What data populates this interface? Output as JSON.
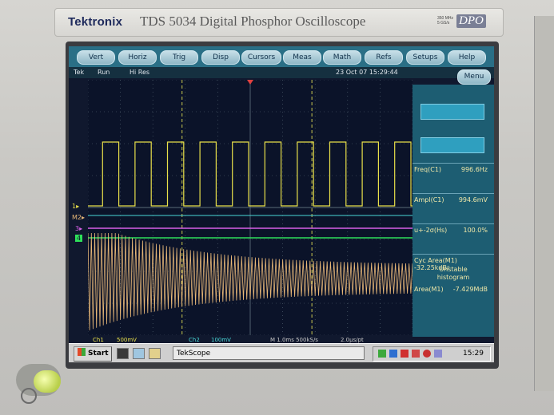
{
  "brand": {
    "logo": "Tektronix",
    "model": "TDS 5034 Digital Phosphor Oscilloscope",
    "spec_line1": "350 MHz",
    "spec_line2": "5 GS/s",
    "badge": "DPO"
  },
  "menu": [
    {
      "label": "Vert"
    },
    {
      "label": "Horiz"
    },
    {
      "label": "Trig"
    },
    {
      "label": "Disp"
    },
    {
      "label": "Cursors"
    },
    {
      "label": "Meas"
    },
    {
      "label": "Math"
    },
    {
      "label": "Refs"
    },
    {
      "label": "Setups"
    },
    {
      "label": "Help"
    }
  ],
  "status": {
    "brand": "Tek",
    "mode": "Run",
    "acq": "Hi Res",
    "datetime": "23 Oct 07 15:29:44",
    "menu_label": "Menu"
  },
  "measurements": [
    {
      "label": "Freq(C1)",
      "value": "996.6Hz"
    },
    {
      "label": "Ampl(C1)",
      "value": "994.6mV"
    },
    {
      "label": "u+-2σ(Hs)",
      "value": "100.0%"
    },
    {
      "label": "Cyc Area(M1)",
      "value": "-32.25kdBr"
    },
    {
      "label": "Area(M1)",
      "value": "-7.429MdB"
    }
  ],
  "measurement_note_line1": "Unstable",
  "measurement_note_line2": "histogram",
  "markers": {
    "m2": "M2",
    "ch3": "3",
    "ch4": "4",
    "ch1": "1"
  },
  "readout": {
    "ch1": "Ch1",
    "ch1_scale": "500mV",
    "ch2": "Ch2",
    "ch2_scale": "100mV",
    "timebase": "M 1.0ms 500kS/s",
    "record": "2.0µs/pt"
  },
  "taskbar": {
    "start": "Start",
    "task": "TekScope",
    "clock": "15:29"
  },
  "colors": {
    "ch1": "#e8e04a",
    "math": "#e8b878",
    "ch3": "#d860e8",
    "ch4": "#2ee05a",
    "cursor": "#c8c850",
    "ref": "#48d8d8",
    "grid": "#5a6b78"
  },
  "chart_data": {
    "type": "line",
    "grid": true,
    "divisions": {
      "x": 10,
      "y": 8
    },
    "series": [
      {
        "channel": "C1",
        "shape": "square wave",
        "frequency_hz": 996.6,
        "amplitude_v": 0.9946,
        "cycles_on_screen": 10
      },
      {
        "channel": "M1",
        "shape": "decaying oscillation",
        "cycles_on_screen": 95
      }
    ]
  }
}
